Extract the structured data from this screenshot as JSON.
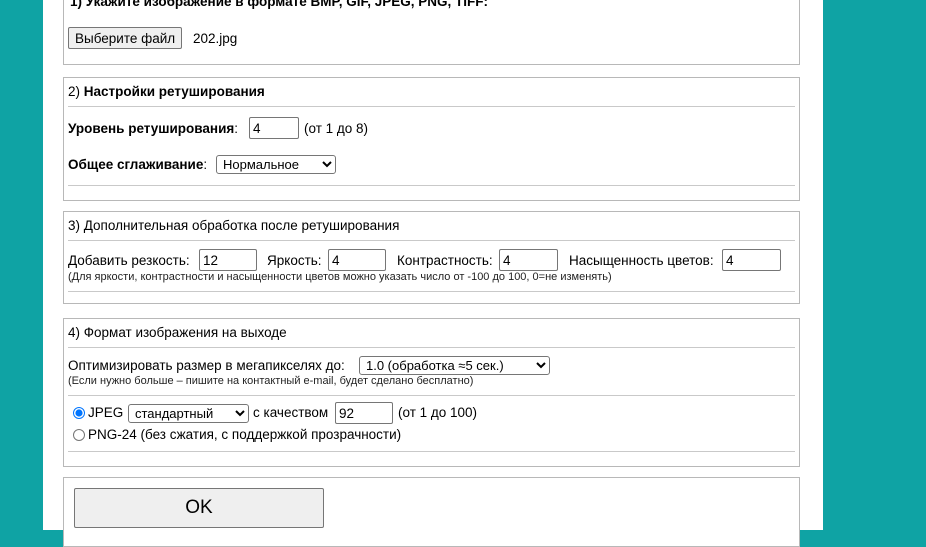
{
  "section1": {
    "title": "1) Укажите изображение в формате BMP, GIF, JPEG, PNG, TIFF:",
    "file_button": "Выберите файл",
    "file_name": "202.jpg"
  },
  "section2": {
    "title_num": "2)",
    "title_text": "Настройки ретуширования",
    "level_label": "Уровень ретуширования",
    "level_colon": ":",
    "level_value": "4",
    "level_hint": "(от 1 до 8)",
    "smooth_label": "Общее сглаживание",
    "smooth_colon": ":",
    "smooth_value": "Нормальное"
  },
  "section3": {
    "title": "3) Дополнительная обработка после ретуширования",
    "sharpness_label": "Добавить резкость:",
    "sharpness_value": "12",
    "brightness_label": "Яркость:",
    "brightness_value": "4",
    "contrast_label": "Контрастность:",
    "contrast_value": "4",
    "saturation_label": "Насыщенность цветов:",
    "saturation_value": "4",
    "note": "(Для яркости, контрастности и насыщенности цветов можно указать число от -100 до 100, 0=не изменять)"
  },
  "section4": {
    "title": "4) Формат изображения на выходе",
    "optimize_label": "Оптимизировать размер в мегапикселях до:",
    "optimize_value": "1.0 (обработка ≈5 сек.)",
    "optimize_note": "(Если нужно больше – пишите на контактный e-mail, будет сделано бесплатно)",
    "jpeg_label": "JPEG",
    "jpeg_mode": "стандартный",
    "quality_label": "с качеством",
    "quality_value": "92",
    "quality_hint": "(от 1 до 100)",
    "png_label": "PNG-24 (без сжатия, с поддержкой прозрачности)"
  },
  "submit": {
    "label": "OK"
  }
}
